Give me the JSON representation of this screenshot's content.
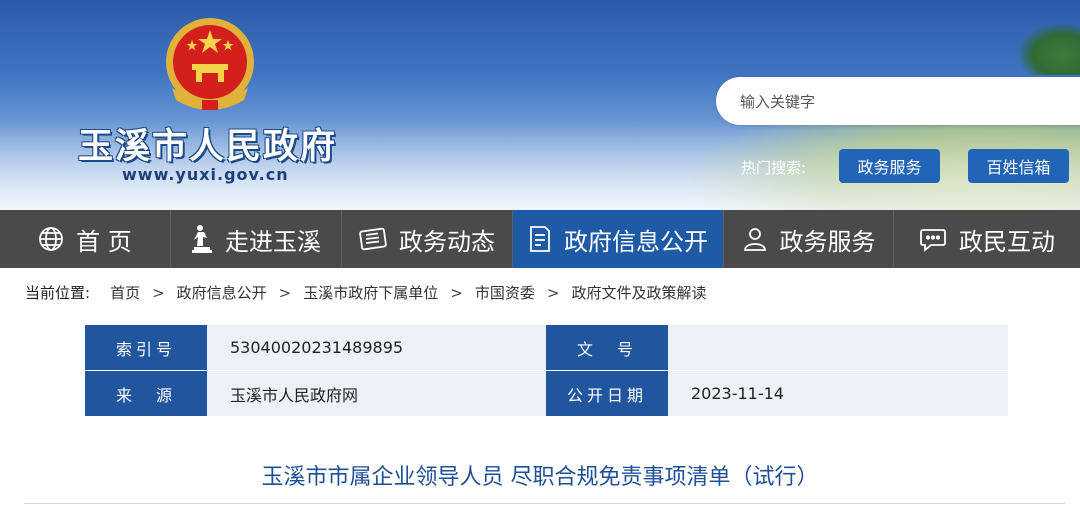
{
  "header": {
    "site_name": "玉溪市人民政府",
    "site_url": "www.yuxi.gov.cn",
    "search_placeholder": "输入关键字",
    "hot_label": "热门搜索:",
    "hot_links": [
      "政务服务",
      "百姓信箱"
    ]
  },
  "nav": {
    "items": [
      {
        "label": "首 页",
        "icon": "globe-icon"
      },
      {
        "label": "走进玉溪",
        "icon": "statue-icon"
      },
      {
        "label": "政务动态",
        "icon": "newspaper-icon"
      },
      {
        "label": "政府信息公开",
        "icon": "document-icon",
        "active": true
      },
      {
        "label": "政务服务",
        "icon": "user-icon"
      },
      {
        "label": "政民互动",
        "icon": "chat-icon"
      }
    ]
  },
  "breadcrumb": {
    "current_label": "当前位置:",
    "items": [
      "首页",
      "政府信息公开",
      "玉溪市政府下属单位",
      "市国资委",
      "政府文件及政策解读"
    ],
    "separator": ">"
  },
  "info": {
    "index_label": "索引号",
    "index_value": "53040020231489895",
    "doc_no_label": "文　号",
    "doc_no_value": "",
    "source_label": "来　源",
    "source_value": "玉溪市人民政府网",
    "date_label": "公开日期",
    "date_value": "2023-11-14"
  },
  "article": {
    "title": "玉溪市市属企业领导人员 尽职合规免责事项清单（试行）"
  },
  "colors": {
    "nav_bg": "#4a4a4a",
    "nav_active": "#1f5aa6",
    "label_bg": "#21559e",
    "value_bg": "#eef0f7",
    "title_color": "#1f4f97"
  }
}
